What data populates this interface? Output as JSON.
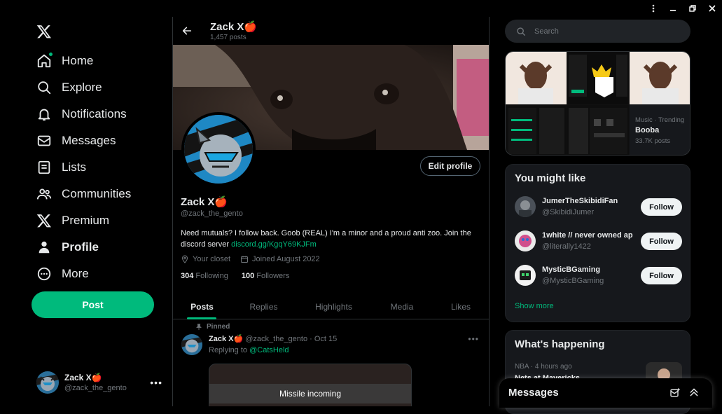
{
  "window": {
    "menu_icon": "more-vertical-icon"
  },
  "nav": {
    "items": [
      {
        "label": "Home",
        "icon": "home-icon"
      },
      {
        "label": "Explore",
        "icon": "search-icon"
      },
      {
        "label": "Notifications",
        "icon": "bell-icon"
      },
      {
        "label": "Messages",
        "icon": "envelope-icon"
      },
      {
        "label": "Lists",
        "icon": "list-icon"
      },
      {
        "label": "Communities",
        "icon": "people-icon"
      },
      {
        "label": "Premium",
        "icon": "x-logo-icon"
      },
      {
        "label": "Profile",
        "icon": "person-icon"
      },
      {
        "label": "More",
        "icon": "more-circle-icon"
      }
    ],
    "post_label": "Post",
    "account": {
      "name": "Zack X🍎",
      "handle": "@zack_the_gento"
    }
  },
  "header": {
    "name": "Zack X🍎",
    "posts": "1,457 posts"
  },
  "profile": {
    "edit_label": "Edit profile",
    "name": "Zack X🍎",
    "handle": "@zack_the_gento",
    "bio": "Need mutuals? I follow back. Goob (REAL) I'm a minor and a proud anti zoo. Join the discord server ",
    "bio_link": "discord.gg/KgqY69KJFm",
    "location": "Your closet",
    "joined": "Joined August 2022",
    "following_count": "304",
    "following_label": "Following",
    "followers_count": "100",
    "followers_label": "Followers"
  },
  "tabs": [
    "Posts",
    "Replies",
    "Highlights",
    "Media",
    "Likes"
  ],
  "tweet": {
    "pinned": "Pinned",
    "name": "Zack X🍎",
    "meta": "@zack_the_gento · Oct 15",
    "replying_prefix": "Replying to ",
    "replying_to": "@CatsHeld",
    "media_caption": "Missile incoming"
  },
  "right": {
    "search_placeholder": "Search",
    "trend": {
      "category": "Music · Trending",
      "title": "Booba",
      "count": "33.7K posts"
    },
    "wtf_title": "You might like",
    "suggestions": [
      {
        "name": "JumerTheSkibidiFan",
        "handle": "@SkibidiJumer",
        "button": "Follow"
      },
      {
        "name": "1white // never owned ap",
        "handle": "@literally1422",
        "button": "Follow"
      },
      {
        "name": "MysticBGaming",
        "handle": "@MysticBGaming",
        "button": "Follow"
      }
    ],
    "show_more": "Show more",
    "happening_title": "What's happening",
    "happening_meta": "NBA · 4 hours ago",
    "happening_item": "Nets at Mavericks"
  },
  "messages_bar": {
    "title": "Messages"
  },
  "colors": {
    "accent": "#00ba7c",
    "bg": "#000000",
    "card": "#16181c",
    "muted": "#71767b"
  }
}
